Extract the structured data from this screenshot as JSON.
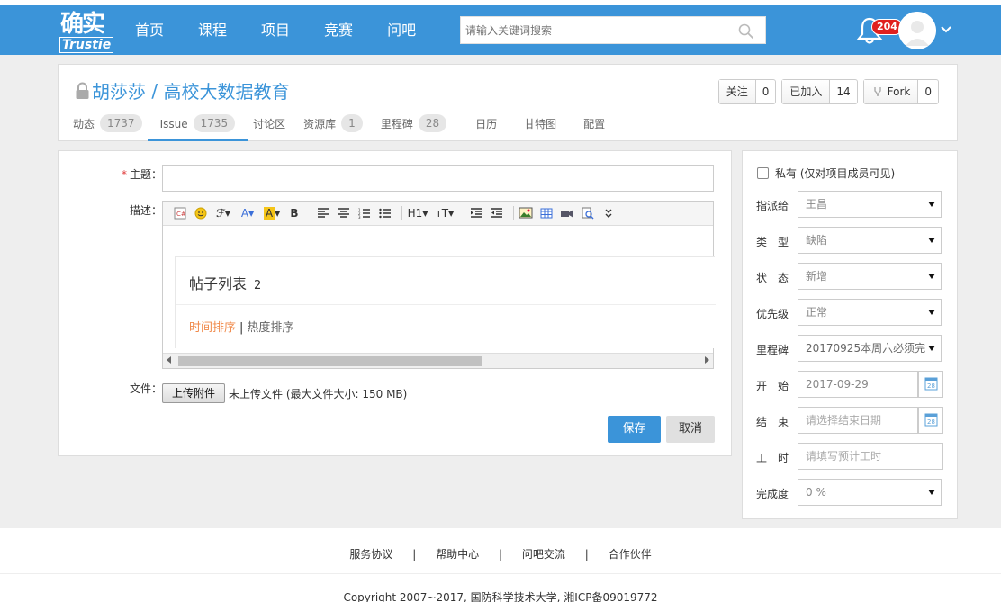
{
  "header": {
    "logo_cn": "确实",
    "logo_en": "Trustie",
    "nav": [
      "首页",
      "课程",
      "项目",
      "竞赛",
      "问吧"
    ],
    "search_placeholder": "请输入关键词搜索",
    "notifications": "204"
  },
  "project": {
    "owner": "胡莎莎",
    "separator": " / ",
    "name": "高校大数据教育",
    "actions": [
      {
        "label": "关注",
        "count": "0"
      },
      {
        "label": "已加入",
        "count": "14"
      },
      {
        "label": "Fork",
        "count": "0"
      }
    ],
    "tabs": [
      {
        "label": "动态",
        "count": "1737"
      },
      {
        "label": "Issue",
        "count": "1735"
      },
      {
        "label": "讨论区",
        "count": ""
      },
      {
        "label": "资源库",
        "count": "1"
      },
      {
        "label": "里程碑",
        "count": "28"
      },
      {
        "label": "日历",
        "count": ""
      },
      {
        "label": "甘特图",
        "count": ""
      },
      {
        "label": "配置",
        "count": ""
      }
    ],
    "active_tab": "Issue"
  },
  "form": {
    "subject_label": "主题",
    "required_mark": "*",
    "colon": "：",
    "desc_label": "描述",
    "file_label": "文件",
    "upload_button": "上传附件",
    "file_note": "未上传文件 (最大文件大小: 150 MB)",
    "save": "保存",
    "cancel": "取消",
    "editor": {
      "post_list_title": "帖子列表",
      "post_count": "2",
      "sort_time": "时间排序",
      "sort_sep": "|",
      "sort_hot": "热度排序",
      "toolbar_h1": "H1",
      "toolbar_tt": "тT",
      "toolbar_b": "B",
      "toolbar_a": "A"
    }
  },
  "side": {
    "private_label": "私有 (仅对项目成员可见)",
    "fields": [
      {
        "label": "指派给",
        "value": "王昌",
        "type": "select"
      },
      {
        "label": "类　型",
        "value": "缺陷",
        "type": "select"
      },
      {
        "label": "状　态",
        "value": "新增",
        "type": "select"
      },
      {
        "label": "优先级",
        "value": "正常",
        "type": "select"
      },
      {
        "label": "里程碑",
        "value": "20170925本周六必须完",
        "type": "select"
      },
      {
        "label": "开　始",
        "value": "2017-09-29",
        "type": "date"
      },
      {
        "label": "结　束",
        "value": "请选择结束日期",
        "type": "date"
      },
      {
        "label": "工　时",
        "value": "请填写预计工时",
        "type": "text"
      },
      {
        "label": "完成度",
        "value": "0 %",
        "type": "select"
      }
    ]
  },
  "footer": {
    "links": [
      "服务协议",
      "帮助中心",
      "问吧交流",
      "合作伙伴"
    ],
    "separator": "|",
    "copyright": "Copyright 2007~2017, 国防科学技术大学,  湘ICP备09019772"
  },
  "colors": {
    "brand": "#3b94d9",
    "badge": "#e0201e",
    "sort_active": "#f08a4b"
  }
}
